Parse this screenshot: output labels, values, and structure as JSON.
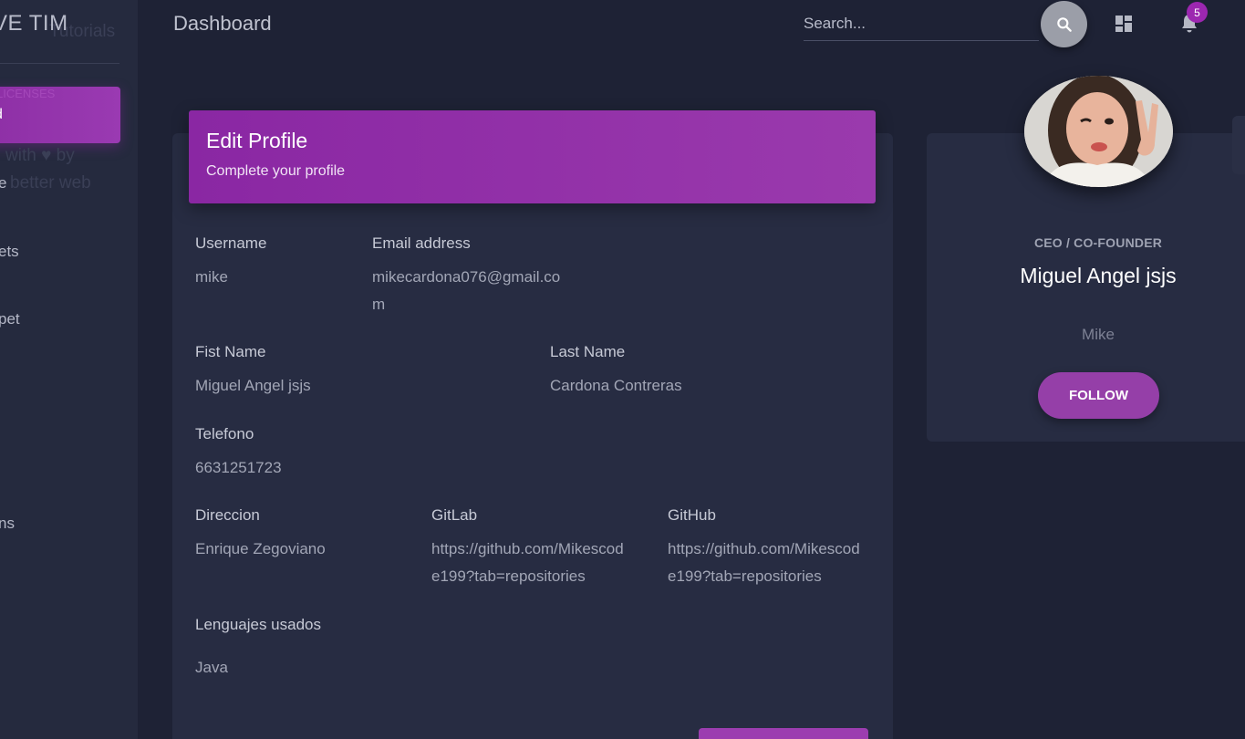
{
  "sidebar": {
    "brand": "VE TIM",
    "brand_ghost": "Tutorials",
    "licenses_ghost": "LICENSES",
    "active_item": "d",
    "ghost_line_1": "with ♥ by",
    "ghost_line_2_prefix": "e",
    "ghost_line_2": "better web",
    "items": [
      {
        "label": "ets"
      },
      {
        "label": "pet"
      },
      {
        "label": "ns"
      }
    ]
  },
  "header": {
    "title": "Dashboard",
    "search_placeholder": "Search...",
    "notifications_count": "5",
    "icons": [
      "search-icon",
      "dashboard-grid-icon",
      "bell-icon"
    ]
  },
  "edit_profile": {
    "title": "Edit Profile",
    "subtitle": "Complete your profile",
    "fields": {
      "username": {
        "label": "Username",
        "value": "mike"
      },
      "email": {
        "label": "Email address",
        "value": "mikecardona076@gmail.com"
      },
      "first_name": {
        "label": "Fist Name",
        "value": "Miguel Angel jsjs"
      },
      "last_name": {
        "label": "Last Name",
        "value": "Cardona Contreras"
      },
      "telefono": {
        "label": "Telefono",
        "value": "6631251723"
      },
      "direccion": {
        "label": "Direccion",
        "value": "Enrique Zegoviano"
      },
      "gitlab": {
        "label": "GitLab",
        "value": "https://github.com/Mikescode199?tab=repositories"
      },
      "github": {
        "label": "GitHub",
        "value": "https://github.com/Mikescode199?tab=repositories"
      },
      "lenguajes": {
        "label": "Lenguajes usados",
        "value": "Java"
      }
    }
  },
  "profile_card": {
    "role": "CEO / CO-FOUNDER",
    "name": "Miguel Angel jsjs",
    "nickname": "Mike",
    "follow_label": "FOLLOW"
  },
  "colors": {
    "accent": "#9c27b0",
    "background": "#1e2235",
    "card": "#272c42"
  }
}
